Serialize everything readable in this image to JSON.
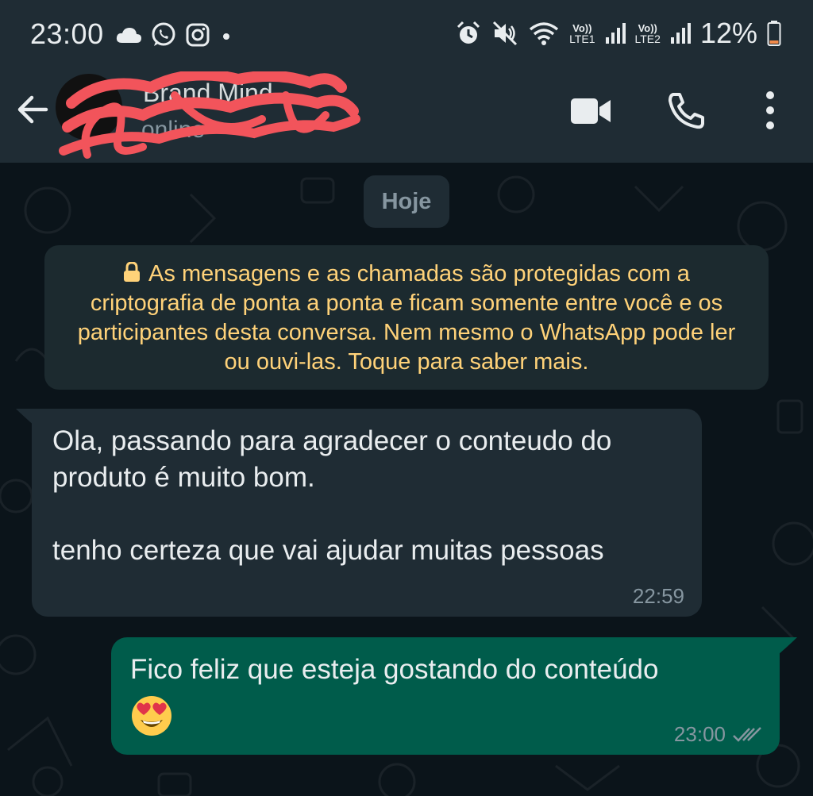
{
  "status_bar": {
    "time": "23:00",
    "left_icons": [
      "cloud-icon",
      "whatsapp-icon",
      "instagram-icon",
      "dot-icon"
    ],
    "right_icons": [
      "alarm-icon",
      "mute-icon",
      "wifi-icon",
      "signal-sim1-icon",
      "signal-sim2-icon",
      "battery-icon"
    ],
    "sim1_label_top": "Vo))",
    "sim1_label_bottom": "LTE1",
    "sim2_label_top": "Vo))",
    "sim2_label_bottom": "LTE2",
    "battery": "12%"
  },
  "header": {
    "contact_name": "Brand Mind",
    "contact_status": "online",
    "icons": [
      "back-arrow-icon",
      "video-call-icon",
      "voice-call-icon",
      "more-options-icon"
    ]
  },
  "chat": {
    "date_chip": "Hoje",
    "e2e_notice": "As mensagens e as chamadas são protegidas com a criptografia de ponta a ponta e ficam somente entre você e os participantes desta conversa. Nem mesmo o WhatsApp pode ler ou ouvi-las. Toque para saber mais.",
    "messages": [
      {
        "direction": "incoming",
        "text": "Ola, passando para agradecer o conteudo do produto é muito bom.\n\ntenho certeza que vai ajudar muitas pessoas",
        "time": "22:59"
      },
      {
        "direction": "outgoing",
        "text": "Fico feliz que esteja gostando do conteúdo",
        "emoji": "smiling-face-with-heart-eyes",
        "time": "23:00",
        "status": "read-double-check"
      }
    ]
  },
  "colors": {
    "bar_bg": "#1f2c34",
    "chat_bg": "#0b141a",
    "incoming_bubble": "#1f2c34",
    "outgoing_bubble": "#005c4b",
    "notice_text": "#ffd279",
    "redaction": "#f2545b"
  }
}
